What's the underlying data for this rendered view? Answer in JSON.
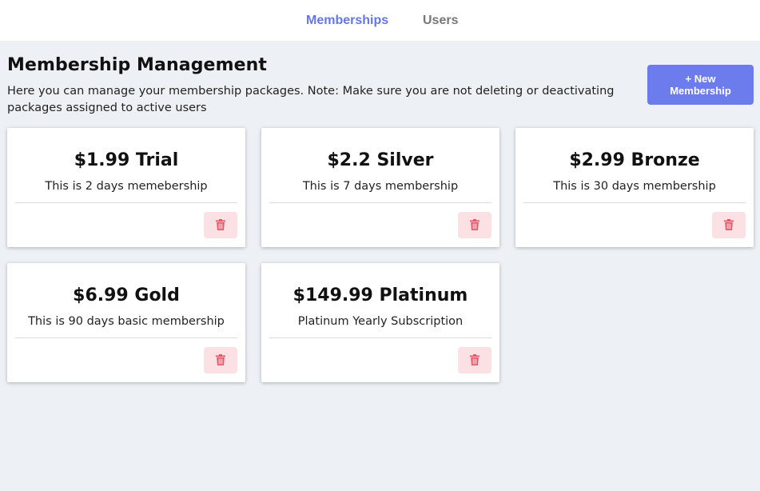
{
  "nav": {
    "tabs": [
      {
        "label": "Memberships",
        "active": true
      },
      {
        "label": "Users",
        "active": false
      }
    ]
  },
  "header": {
    "title": "Membership Management",
    "description": "Here you can manage your membership packages. Note: Make sure you are not deleting or deactivating packages assigned to active users",
    "new_button_label": "+ New Membership"
  },
  "memberships": [
    {
      "title": "$1.99 Trial",
      "description": "This is 2 days memebership"
    },
    {
      "title": "$2.2 Silver",
      "description": "This is 7 days membership"
    },
    {
      "title": "$2.99 Bronze",
      "description": "This is 30 days membership"
    },
    {
      "title": "$6.99 Gold",
      "description": "This is 90 days basic membership"
    },
    {
      "title": "$149.99 Platinum",
      "description": "Platinum Yearly Subscription"
    }
  ],
  "icons": {
    "delete": "trash-icon"
  },
  "colors": {
    "accent": "#6c7ced",
    "active_tab": "#6676e6",
    "inactive_tab": "#777777",
    "page_bg": "#edf1f5",
    "delete_bg": "#fbe0e4",
    "delete_icon": "#e05a6a"
  }
}
